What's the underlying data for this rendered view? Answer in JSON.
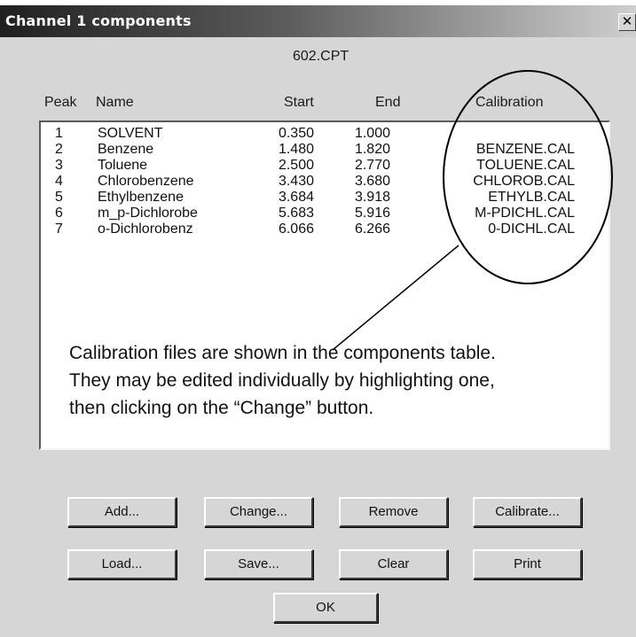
{
  "window": {
    "title": "Channel 1 components",
    "close_glyph": "✕"
  },
  "file_name": "602.CPT",
  "columns": {
    "peak": "Peak",
    "name": "Name",
    "start": "Start",
    "end": "End",
    "calibration": "Calibration"
  },
  "rows": [
    {
      "peak": "1",
      "name": "SOLVENT",
      "start": "0.350",
      "end": "1.000",
      "calibration": ""
    },
    {
      "peak": "2",
      "name": "Benzene",
      "start": "1.480",
      "end": "1.820",
      "calibration": "BENZENE.CAL"
    },
    {
      "peak": "3",
      "name": "Toluene",
      "start": "2.500",
      "end": "2.770",
      "calibration": "TOLUENE.CAL"
    },
    {
      "peak": "4",
      "name": "Chlorobenzene",
      "start": "3.430",
      "end": "3.680",
      "calibration": "CHLOROB.CAL"
    },
    {
      "peak": "5",
      "name": "Ethylbenzene",
      "start": "3.684",
      "end": "3.918",
      "calibration": "ETHYLB.CAL"
    },
    {
      "peak": "6",
      "name": "m_p-Dichlorobe",
      "start": "5.683",
      "end": "5.916",
      "calibration": "M-PDICHL.CAL"
    },
    {
      "peak": "7",
      "name": "o-Dichlorobenz",
      "start": "6.066",
      "end": "6.266",
      "calibration": "0-DICHL.CAL"
    }
  ],
  "annotation": {
    "lines": [
      "Calibration files are shown in the components table.",
      "They may be edited individually by highlighting one,",
      "then clicking on the “Change” button."
    ]
  },
  "buttons": {
    "add": "Add...",
    "change": "Change...",
    "remove": "Remove",
    "calibrate": "Calibrate...",
    "load": "Load...",
    "save": "Save...",
    "clear": "Clear",
    "print": "Print",
    "ok": "OK"
  }
}
